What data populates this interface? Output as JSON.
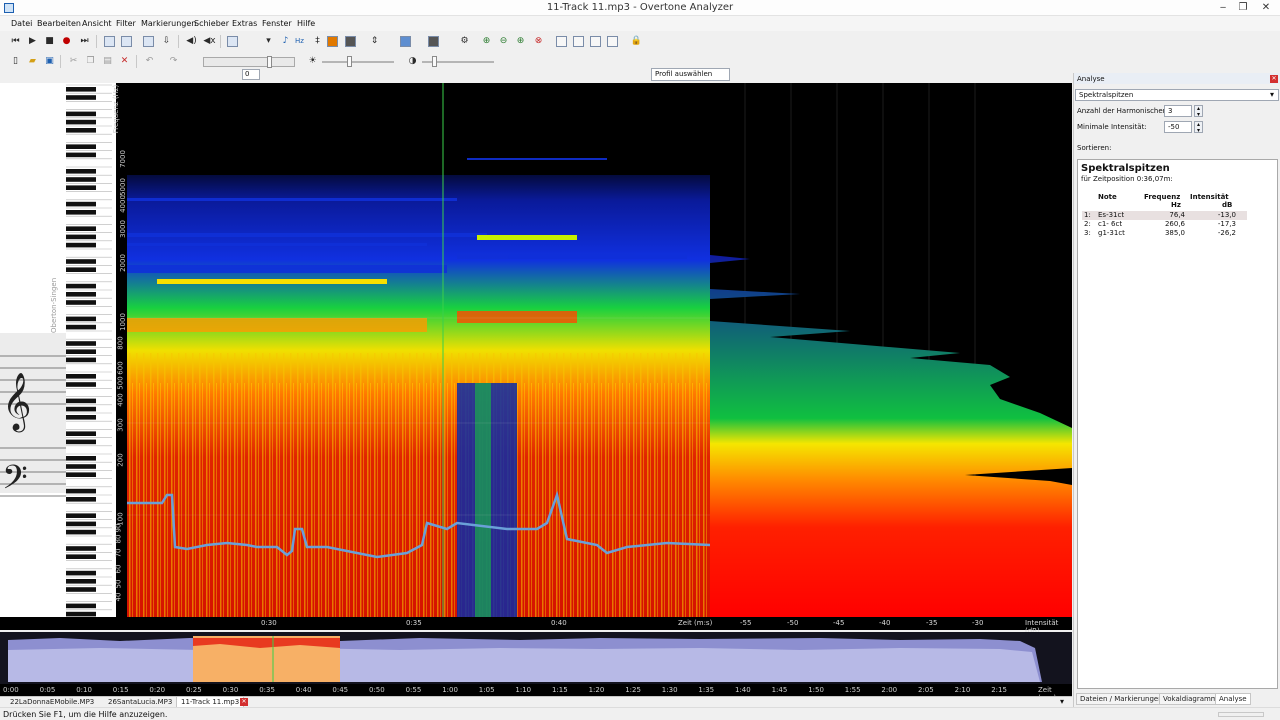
{
  "window": {
    "title": "11-Track 11.mp3 - Overtone Analyzer",
    "min": "‒",
    "max": "❐",
    "close": "✕"
  },
  "menu": [
    "Datei",
    "Bearbeiten",
    "Ansicht",
    "Filter",
    "Markierungen",
    "Schieber",
    "Extras",
    "Fenster",
    "Hilfe"
  ],
  "toolbar": {
    "loop_value": "0",
    "profile": "Profil auswählen",
    "hz_label": "Hz"
  },
  "spectrogram": {
    "freq_label": "Frequenz (Hz)",
    "freq_ticks": [
      "7000",
      "5000",
      "4000",
      "3000",
      "2000",
      "1000",
      "800",
      "600",
      "500",
      "400",
      "300",
      "200",
      "100",
      "90",
      "80",
      "70",
      "60",
      "50",
      "40"
    ],
    "time_ticks": [
      "0:30",
      "0:35",
      "0:40"
    ],
    "time_axis_label": "Zeit (m:s)",
    "intensity_ticks": [
      "-55",
      "-50",
      "-45",
      "-40",
      "-35",
      "-30"
    ],
    "intensity_axis_label": "Intensität (dB)",
    "clef_text": "Oberton-Singen"
  },
  "overview": {
    "ticks": [
      "0:00",
      "0:05",
      "0:10",
      "0:15",
      "0:20",
      "0:25",
      "0:30",
      "0:35",
      "0:40",
      "0:45",
      "0:50",
      "0:55",
      "1:00",
      "1:05",
      "1:10",
      "1:15",
      "1:20",
      "1:25",
      "1:30",
      "1:35",
      "1:40",
      "1:45",
      "1:50",
      "1:55",
      "2:00",
      "2:05",
      "2:10",
      "2:15"
    ],
    "axis_label": "Zeit (m:s)"
  },
  "file_tabs": [
    "22LaDonnaEMobile.MP3",
    "26SantaLucia.MP3",
    "11-Track 11.mp3"
  ],
  "status": "Drücken Sie F1, um die Hilfe anzuzeigen.",
  "analysis": {
    "header": "Analyse",
    "mode": "Spektralspitzen",
    "harmonics_label": "Anzahl der Harmonischen:",
    "harmonics_value": "3",
    "min_intensity_label": "Minimale Intensität:",
    "min_intensity_value": "-50",
    "sort_label": "Sortieren:",
    "result_title": "Spektralspitzen",
    "result_subtitle": "für Zeitposition 0:36,07m:",
    "columns": {
      "note": "Note",
      "freq": "Frequenz",
      "freq_unit": "Hz",
      "int": "Intensität",
      "int_unit": "dB"
    },
    "rows": [
      {
        "idx": "1:",
        "note": "Es-31ct",
        "freq": "76,4",
        "int": "-13,0"
      },
      {
        "idx": "2:",
        "note": "c1- 6ct",
        "freq": "260,6",
        "int": "-17,3"
      },
      {
        "idx": "3:",
        "note": "g1-31ct",
        "freq": "385,0",
        "int": "-26,2"
      }
    ],
    "bottom_tabs": [
      "Dateien / Markierungen",
      "Vokaldiagramm",
      "Analyse"
    ]
  },
  "colors": {
    "spectrum_red": "#d51200",
    "accent_blue": "#1c5fb0",
    "pitch_line": "#6aa0d8"
  }
}
